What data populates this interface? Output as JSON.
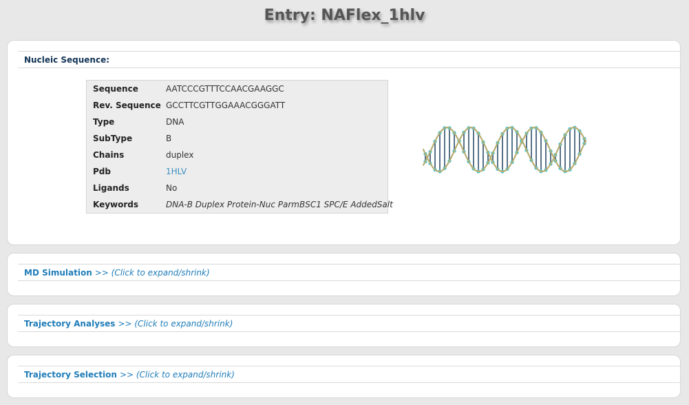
{
  "page": {
    "title": "Entry: NAFlex_1hlv"
  },
  "nucleic": {
    "header": "Nucleic Sequence:",
    "rows": [
      {
        "key": "Sequence",
        "value": "AATCCCGTTTCCAACGAAGGC"
      },
      {
        "key": "Rev. Sequence",
        "value": "GCCTTCGTTGGAAACGGGATT"
      },
      {
        "key": "Type",
        "value": "DNA"
      },
      {
        "key": "SubType",
        "value": "B"
      },
      {
        "key": "Chains",
        "value": "duplex"
      },
      {
        "key": "Pdb",
        "value": "1HLV"
      },
      {
        "key": "Ligands",
        "value": "No"
      },
      {
        "key": "Keywords",
        "value": "DNA-B Duplex Protein-Nuc ParmBSC1 SPC/E AddedSalt"
      }
    ]
  },
  "sections": [
    {
      "label": "MD Simulation",
      "hint": ">> (Click to expand/shrink)"
    },
    {
      "label": "Trajectory Analyses",
      "hint": ">> (Click to expand/shrink)"
    },
    {
      "label": "Trajectory Selection",
      "hint": ">> (Click to expand/shrink)"
    }
  ],
  "colors": {
    "link": "#1f7cb8",
    "background": "#e8e8e8",
    "strand": "#b8ae72",
    "base": "#45c3d0"
  }
}
